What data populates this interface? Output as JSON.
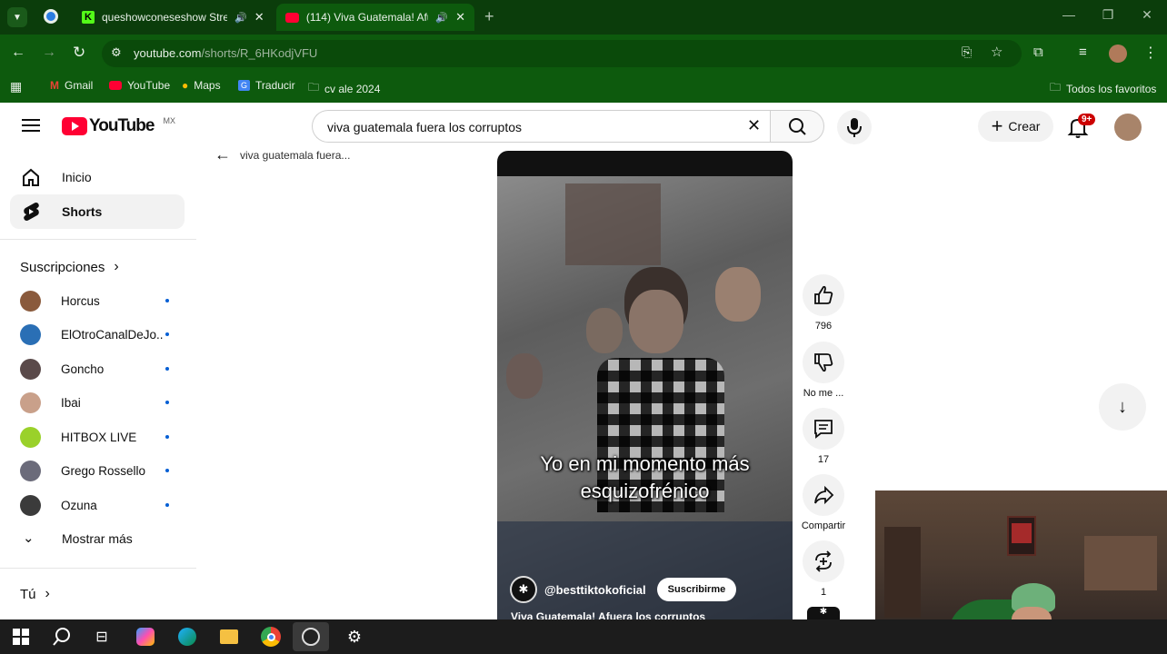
{
  "browser": {
    "tabs": [
      {
        "title": "queshowconeseshow Strea",
        "icon": "kick-icon"
      },
      {
        "title": "(114) Viva Guatemala! Afuer",
        "icon": "youtube-icon"
      }
    ],
    "url_host": "youtube.com",
    "url_path": "/shorts/R_6HKodjVFU",
    "bookmarks": [
      "Gmail",
      "YouTube",
      "Maps",
      "Traducir",
      "cv ale 2024"
    ],
    "all_bookmarks": "Todos los favoritos"
  },
  "youtube": {
    "logo_text": "YouTube",
    "region": "MX",
    "search_query": "viva guatemala fuera los corruptos",
    "create_label": "Crear",
    "notif_badge": "9+",
    "back_title": "viva guatemala fuera..."
  },
  "sidebar": {
    "items": [
      {
        "label": "Inicio",
        "icon": "home-icon"
      },
      {
        "label": "Shorts",
        "icon": "shorts-icon"
      }
    ],
    "subs_title": "Suscripciones",
    "subscriptions": [
      {
        "name": "Horcus",
        "color": "#8a5a3c"
      },
      {
        "name": "ElOtroCanalDeJo...",
        "color": "#2a6fb5"
      },
      {
        "name": "Goncho",
        "color": "#5a4a4a"
      },
      {
        "name": "Ibai",
        "color": "#c9a08a"
      },
      {
        "name": "HITBOX LIVE",
        "color": "#9ad12a"
      },
      {
        "name": "Grego Rossello",
        "color": "#6b6b7a"
      },
      {
        "name": "Ozuna",
        "color": "#3b3b3b"
      }
    ],
    "show_more": "Mostrar más",
    "you": "Tú"
  },
  "short": {
    "caption_line1": "Yo en mi momento más",
    "caption_line2": "esquizofrénico",
    "channel": "@besttiktokoficial",
    "subscribe": "Suscribirme",
    "title": "Viva Guatemala! Afuera los corruptos",
    "likes": "796",
    "dislike": "No me ...",
    "comments": "17",
    "share": "Compartir",
    "remix": "1"
  },
  "colors": {
    "browser_dark": "#0b3d0b",
    "browser_green": "#0d5a0d",
    "youtube_red": "#ff0033"
  }
}
